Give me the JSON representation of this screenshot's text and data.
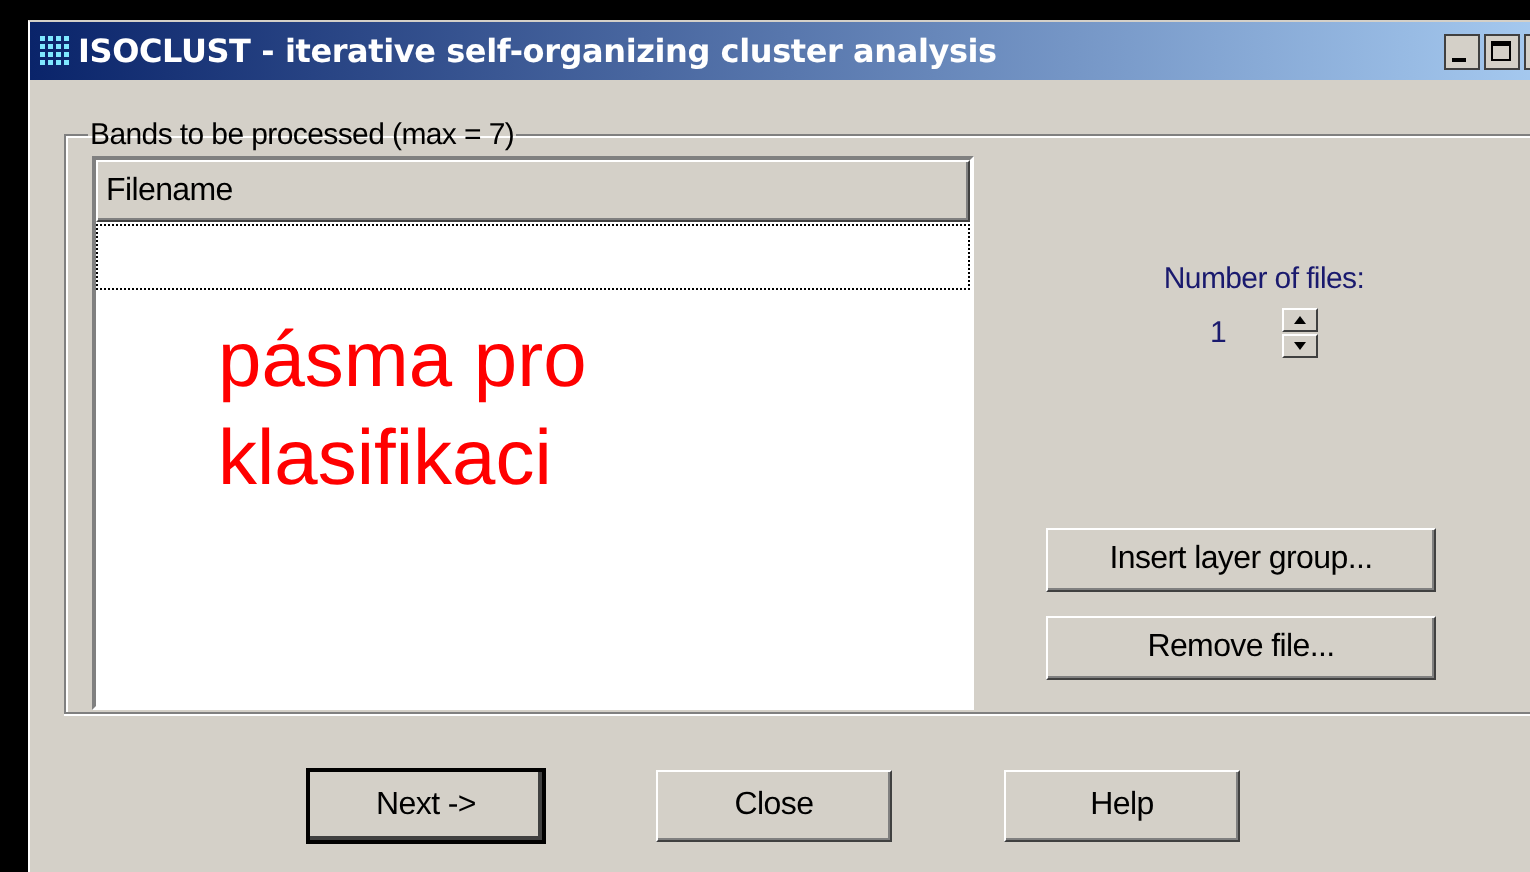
{
  "window": {
    "title": "ISOCLUST - iterative self-organizing cluster analysis"
  },
  "group": {
    "label": "Bands to be processed (max = 7)"
  },
  "file_list": {
    "columns": [
      "Filename"
    ],
    "rows": [
      {
        "selected": true
      }
    ]
  },
  "annotation": {
    "text": "pásma pro klasifikaci"
  },
  "file_count": {
    "label": "Number of files:",
    "value": "1"
  },
  "side_buttons": [
    "Insert layer group...",
    "Remove file..."
  ],
  "buttons": [
    {
      "label": "Next ->",
      "default": true
    },
    {
      "label": "Close",
      "default": false
    },
    {
      "label": "Help",
      "default": false
    }
  ]
}
